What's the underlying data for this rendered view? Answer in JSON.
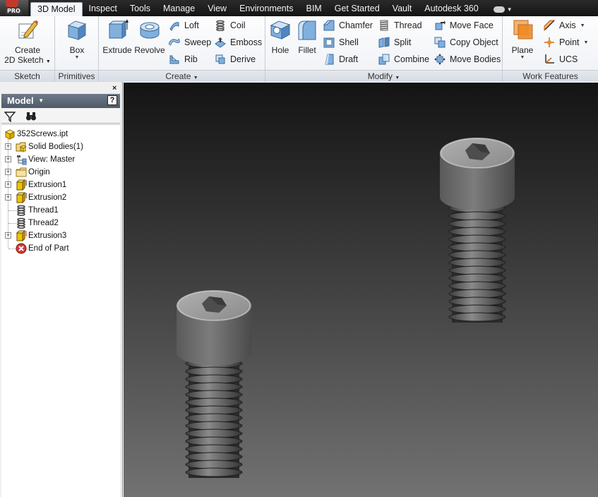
{
  "app": {
    "badge": "PRO"
  },
  "tabs": [
    "3D Model",
    "Inspect",
    "Tools",
    "Manage",
    "View",
    "Environments",
    "BIM",
    "Get Started",
    "Vault",
    "Autodesk 360"
  ],
  "active_tab": "3D Model",
  "ribbon": {
    "sketch": {
      "title": "Sketch",
      "create_line1": "Create",
      "create_line2": "2D Sketch"
    },
    "primitives": {
      "title": "Primitives",
      "box": "Box"
    },
    "create": {
      "title": "Create",
      "extrude": "Extrude",
      "revolve": "Revolve",
      "loft": "Loft",
      "sweep": "Sweep",
      "rib": "Rib",
      "coil": "Coil",
      "emboss": "Emboss",
      "derive": "Derive"
    },
    "modify": {
      "title": "Modify",
      "hole": "Hole",
      "fillet": "Fillet",
      "chamfer": "Chamfer",
      "shell": "Shell",
      "draft": "Draft",
      "thread": "Thread",
      "split": "Split",
      "combine": "Combine",
      "move_face": "Move Face",
      "copy_object": "Copy Object",
      "move_bodies": "Move Bodies"
    },
    "work_features": {
      "title": "Work Features",
      "plane": "Plane",
      "axis": "Axis",
      "point": "Point",
      "ucs": "UCS"
    }
  },
  "browser": {
    "close": "×",
    "title": "Model",
    "help": "?",
    "tree": [
      {
        "label": "352Screws.ipt",
        "icon": "part-icon"
      },
      {
        "label": "Solid Bodies(1)",
        "icon": "solid-bodies-folder-icon"
      },
      {
        "label": "View: Master",
        "icon": "view-rep-icon"
      },
      {
        "label": "Origin",
        "icon": "folder-icon"
      },
      {
        "label": "Extrusion1",
        "icon": "extrusion-icon"
      },
      {
        "label": "Extrusion2",
        "icon": "extrusion-icon"
      },
      {
        "label": "Thread1",
        "icon": "thread-icon"
      },
      {
        "label": "Thread2",
        "icon": "thread-icon"
      },
      {
        "label": "Extrusion3",
        "icon": "extrusion-icon"
      },
      {
        "label": "End of Part",
        "icon": "end-of-part-icon"
      }
    ]
  },
  "colors": {
    "ribbon_bg": "#f3f5f8",
    "browser_header": "#5c6875",
    "viewport_top": "#141414",
    "viewport_bottom": "#727272",
    "screw_head": "#6e6e6e",
    "screw_face": "#9a9a9a"
  }
}
